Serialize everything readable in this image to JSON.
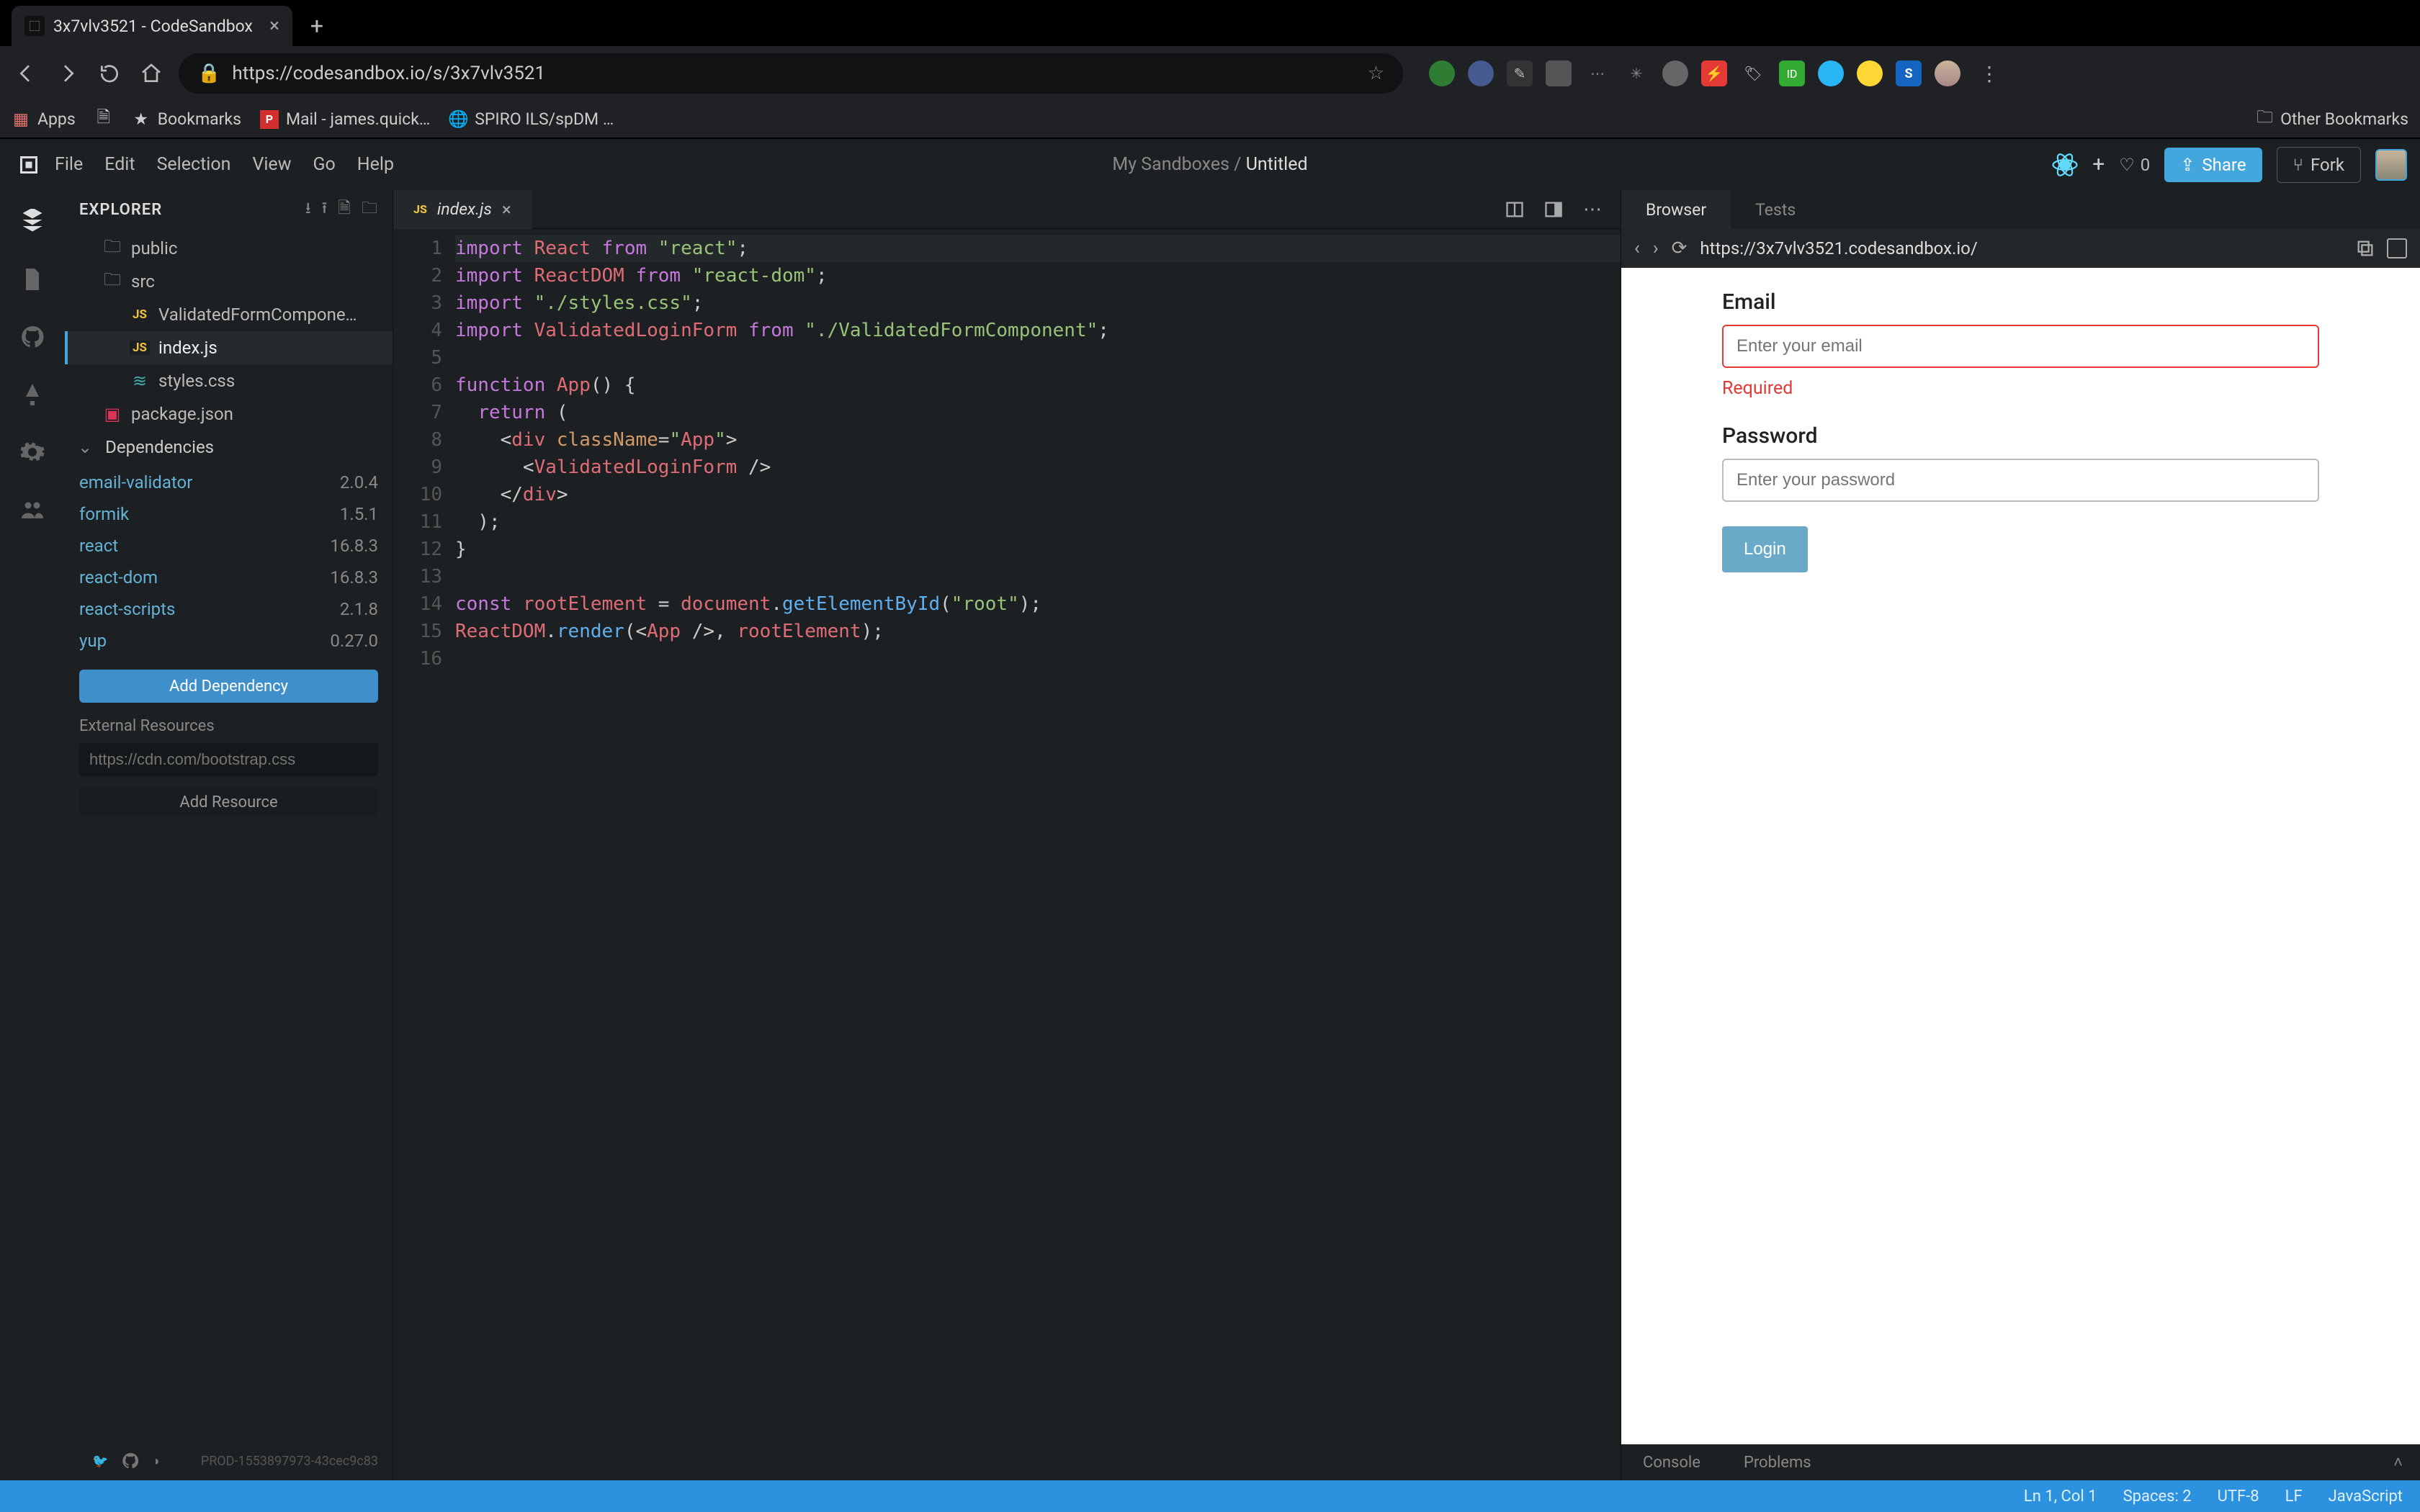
{
  "browser": {
    "tab_title": "3x7vlv3521 - CodeSandbox",
    "url": "https://codesandbox.io/s/3x7vlv3521",
    "bookmarks_bar": {
      "apps": "Apps",
      "bookmarks": "Bookmarks",
      "mail": "Mail - james.quick…",
      "spiro": "SPIRO ILS/spDM …",
      "other": "Other Bookmarks"
    }
  },
  "cs_header": {
    "menu": {
      "file": "File",
      "edit": "Edit",
      "selection": "Selection",
      "view": "View",
      "go": "Go",
      "help": "Help"
    },
    "breadcrumb_prefix": "My Sandboxes / ",
    "breadcrumb_title": "Untitled",
    "likes": "0",
    "share": "Share",
    "fork": "Fork"
  },
  "explorer": {
    "title": "EXPLORER",
    "files": {
      "public": "public",
      "src": "src",
      "validated_form": "ValidatedFormCompone…",
      "index_js": "index.js",
      "styles_css": "styles.css",
      "package_json": "package.json"
    },
    "dependencies_label": "Dependencies",
    "deps": [
      {
        "name": "email-validator",
        "ver": "2.0.4"
      },
      {
        "name": "formik",
        "ver": "1.5.1"
      },
      {
        "name": "react",
        "ver": "16.8.3"
      },
      {
        "name": "react-dom",
        "ver": "16.8.3"
      },
      {
        "name": "react-scripts",
        "ver": "2.1.8"
      },
      {
        "name": "yup",
        "ver": "0.27.0"
      }
    ],
    "add_dependency": "Add Dependency",
    "ext_resources_label": "External Resources",
    "ext_resources_placeholder": "https://cdn.com/bootstrap.css",
    "add_resource": "Add Resource",
    "build_tag": "PROD-1553897973-43cec9c83"
  },
  "editor": {
    "tab_file": "index.js",
    "lines": [
      "import React from \"react\";",
      "import ReactDOM from \"react-dom\";",
      "import \"./styles.css\";",
      "import ValidatedLoginForm from \"./ValidatedFormComponent\";",
      "",
      "function App() {",
      "  return (",
      "    <div className=\"App\">",
      "      <ValidatedLoginForm />",
      "    </div>",
      "  );",
      "}",
      "",
      "const rootElement = document.getElementById(\"root\");",
      "ReactDOM.render(<App />, rootElement);",
      ""
    ]
  },
  "preview": {
    "tab_browser": "Browser",
    "tab_tests": "Tests",
    "url": "https://3x7vlv3521.codesandbox.io/",
    "email_label": "Email",
    "email_placeholder": "Enter your email",
    "email_error": "Required",
    "password_label": "Password",
    "password_placeholder": "Enter your password",
    "login_label": "Login",
    "console": "Console",
    "problems": "Problems"
  },
  "statusbar": {
    "pos": "Ln 1, Col 1",
    "spaces": "Spaces: 2",
    "encoding": "UTF-8",
    "eol": "LF",
    "lang": "JavaScript"
  }
}
